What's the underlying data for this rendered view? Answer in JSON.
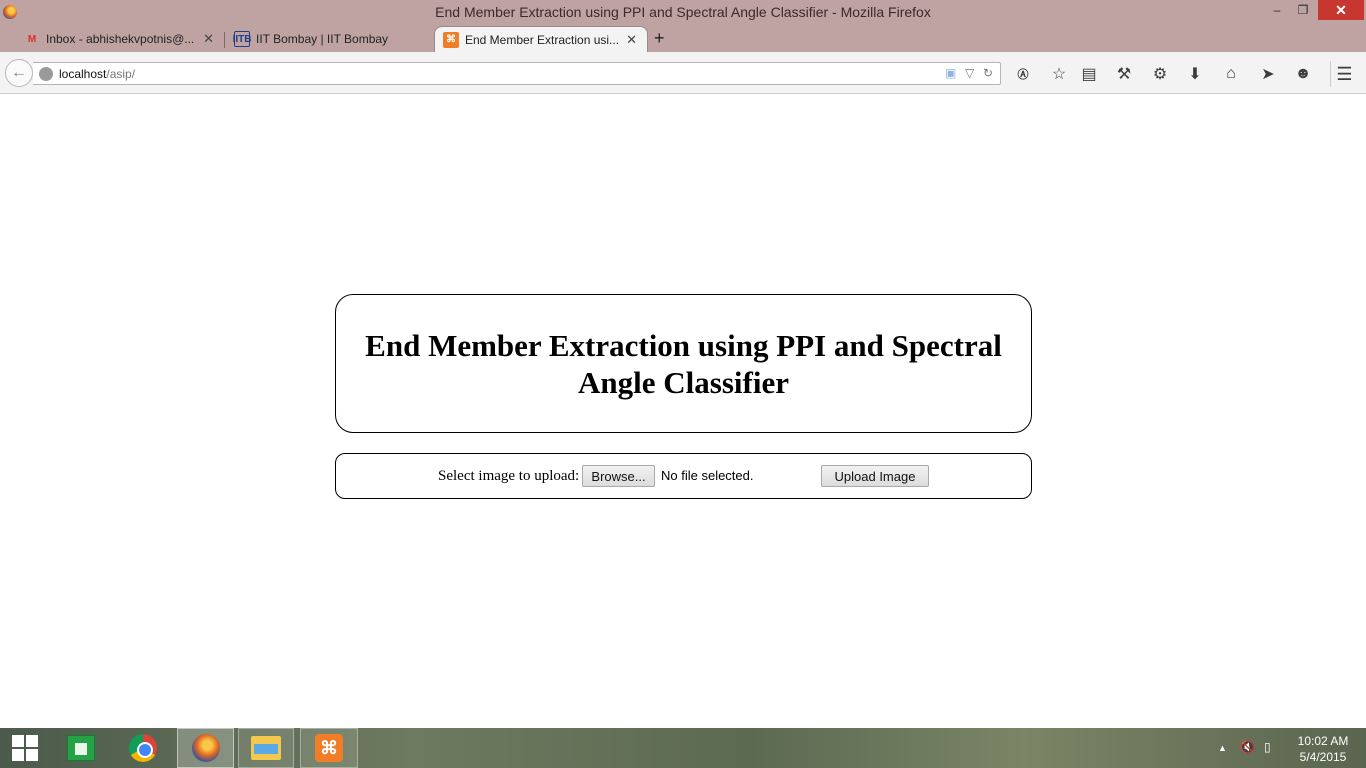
{
  "window": {
    "title": "End Member Extraction using PPI and Spectral Angle Classifier - Mozilla Firefox",
    "min_glyph": "–",
    "max_glyph": "❐",
    "close_glyph": "✕"
  },
  "tabs": [
    {
      "label": "Inbox - abhishekvpotnis@...",
      "icon": "gmail-icon",
      "close": "✕"
    },
    {
      "label": "IIT Bombay | IIT Bombay",
      "icon": "iitb-icon",
      "close": ""
    },
    {
      "label": "End Member Extraction usi...",
      "icon": "xampp-icon",
      "close": "✕",
      "active": true
    }
  ],
  "new_tab_glyph": "+",
  "navbar": {
    "back_glyph": "←",
    "url_host": "localhost",
    "url_path": "/asip/",
    "toolbar_icons": [
      "abp-icon",
      "bookmark-star-icon",
      "reading-list-icon",
      "wrench-icon",
      "gear-icon",
      "download-icon",
      "home-icon",
      "send-icon",
      "chat-icon"
    ],
    "menu_glyph": "☰"
  },
  "page": {
    "heading": "End Member Extraction using PPI and Spectral Angle Classifier",
    "upload_label": "Select image to upload:",
    "browse_button": "Browse...",
    "file_status": "No file selected.",
    "upload_button": "Upload Image"
  },
  "taskbar": {
    "apps": [
      "start",
      "store",
      "chrome",
      "firefox",
      "file-explorer",
      "xampp"
    ],
    "xampp_glyph": "⌘",
    "tray_up": "▲",
    "time": "10:02 AM",
    "date": "5/4/2015"
  },
  "colors": {
    "titlebar": "#bfa3a3",
    "close_button": "#c7372f",
    "active_tab": "#f3f3f3"
  }
}
